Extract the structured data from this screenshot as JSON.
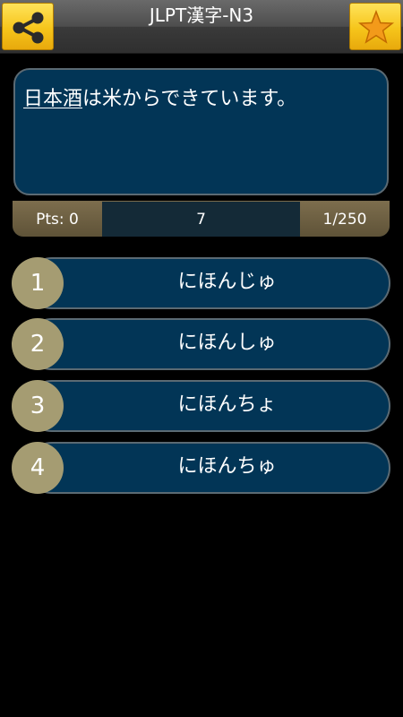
{
  "header": {
    "title": "JLPT漢字-N3",
    "share_icon": "share-icon",
    "star_icon": "star-icon",
    "accent": "#f6c51b"
  },
  "question": {
    "kanji": "日本酒",
    "rest": "は米からできています。"
  },
  "status": {
    "points": "Pts: 0",
    "current": "7",
    "progress": "1/250"
  },
  "answers": [
    {
      "number": "1",
      "text": "にほんじゅ"
    },
    {
      "number": "2",
      "text": "にほんしゅ"
    },
    {
      "number": "3",
      "text": "にほんちょ"
    },
    {
      "number": "4",
      "text": "にほんちゅ"
    }
  ],
  "colors": {
    "panel": "#023556",
    "number_circle": "#a59c72",
    "status_side": "#7c6d4d"
  }
}
